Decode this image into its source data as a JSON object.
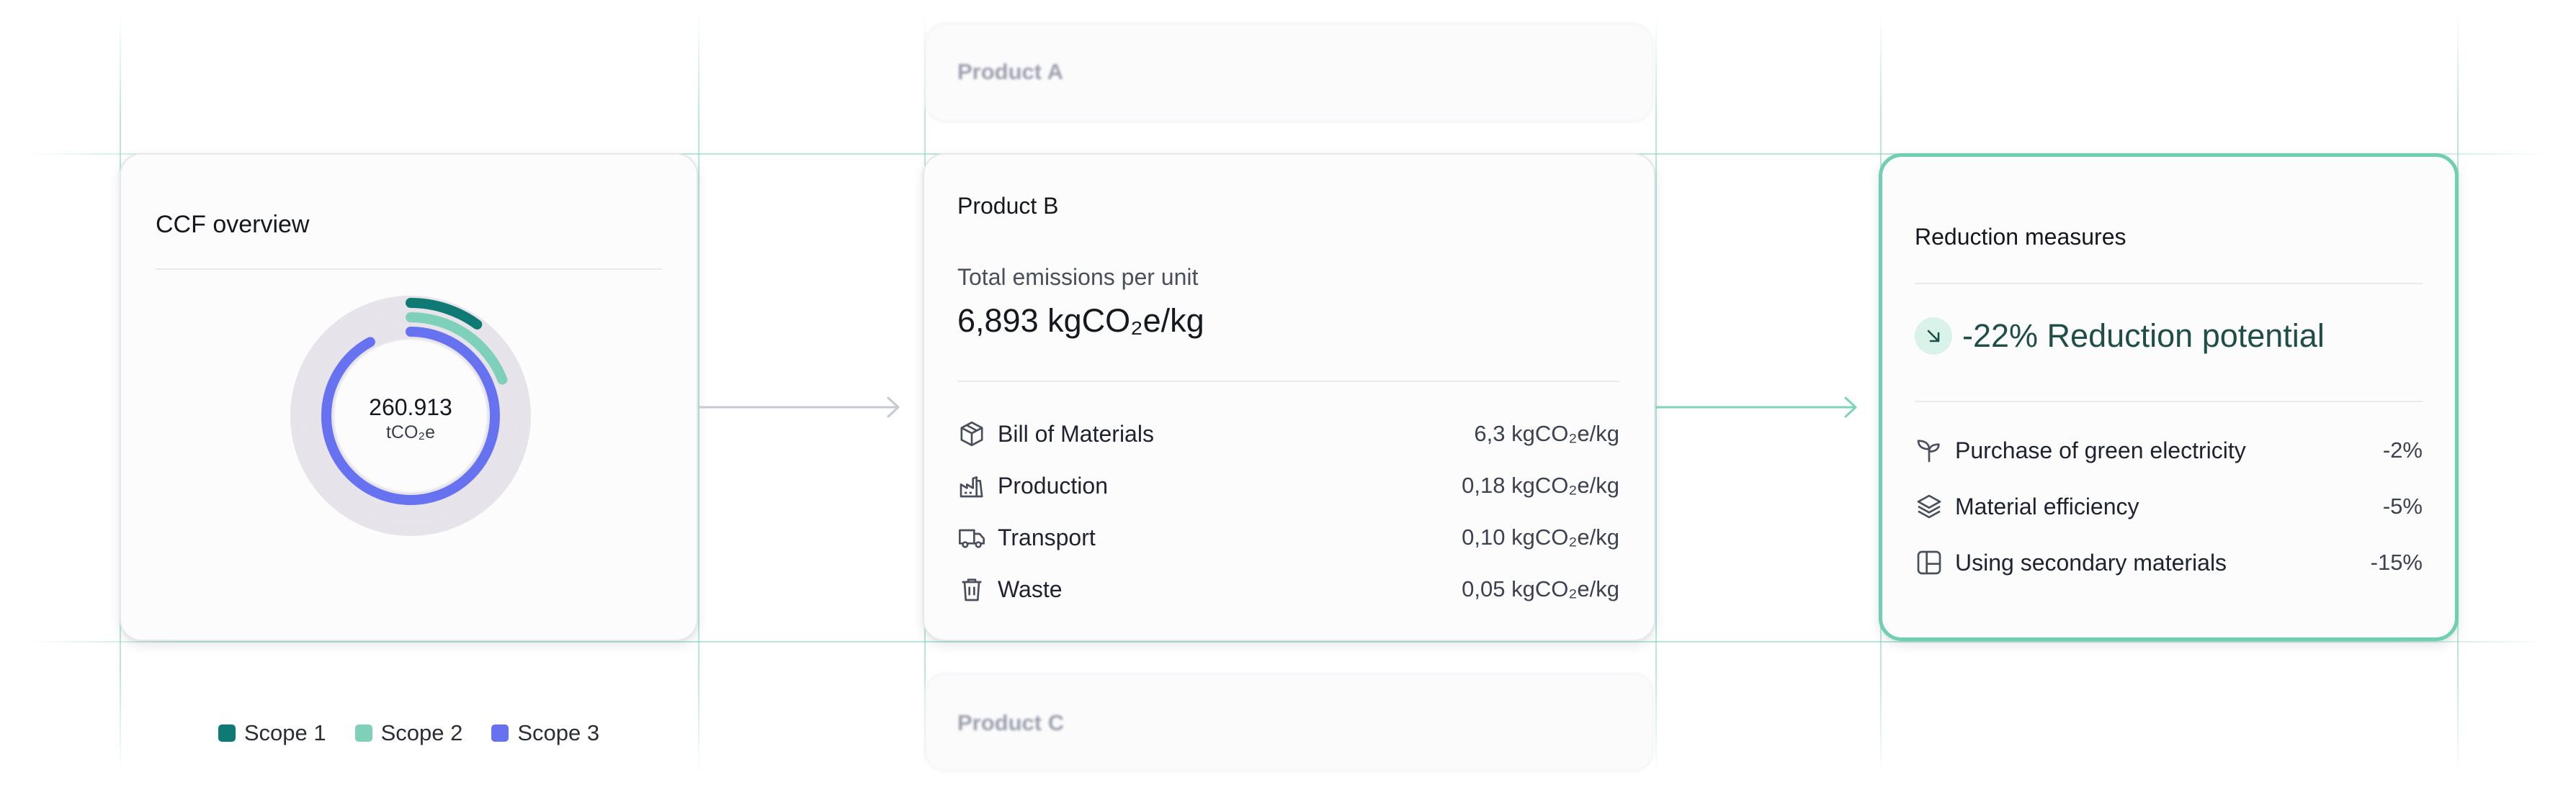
{
  "ccf_card": {
    "title": "CCF overview",
    "total_value": "260.913",
    "total_unit": "tCO₂e",
    "legend": [
      {
        "label": "Scope 1",
        "color": "#0f7a73"
      },
      {
        "label": "Scope 2",
        "color": "#7fd0bb"
      },
      {
        "label": "Scope 3",
        "color": "#6672f0"
      }
    ],
    "rings": [
      {
        "name": "Scope 1",
        "color": "#0f7a73",
        "fraction": 0.1
      },
      {
        "name": "Scope 2",
        "color": "#7fd0bb",
        "fraction": 0.19
      },
      {
        "name": "Scope 3",
        "color": "#6672f0",
        "fraction": 0.92
      }
    ]
  },
  "products": {
    "ghost_top": "Product A",
    "ghost_bottom": "Product C",
    "card": {
      "title": "Product B",
      "emissions_label": "Total emissions per unit",
      "emissions_value": "6,893 kgCO₂e/kg",
      "rows": [
        {
          "icon": "box-icon",
          "label": "Bill of Materials",
          "value": "6,3 kgCO₂e/kg"
        },
        {
          "icon": "factory-icon",
          "label": "Production",
          "value": "0,18 kgCO₂e/kg"
        },
        {
          "icon": "truck-icon",
          "label": "Transport",
          "value": "0,10 kgCO₂e/kg"
        },
        {
          "icon": "trash-icon",
          "label": "Waste",
          "value": "0,05 kgCO₂e/kg"
        }
      ]
    }
  },
  "reduction_card": {
    "title": "Reduction measures",
    "potential": "-22% Reduction potential",
    "accent_color": "#6fcfb0",
    "rows": [
      {
        "icon": "sprout-icon",
        "label": "Purchase of green electricity",
        "value": "-2%"
      },
      {
        "icon": "layers-icon",
        "label": "Material efficiency",
        "value": "-5%"
      },
      {
        "icon": "panel-icon",
        "label": "Using secondary materials",
        "value": "-15%"
      }
    ]
  }
}
